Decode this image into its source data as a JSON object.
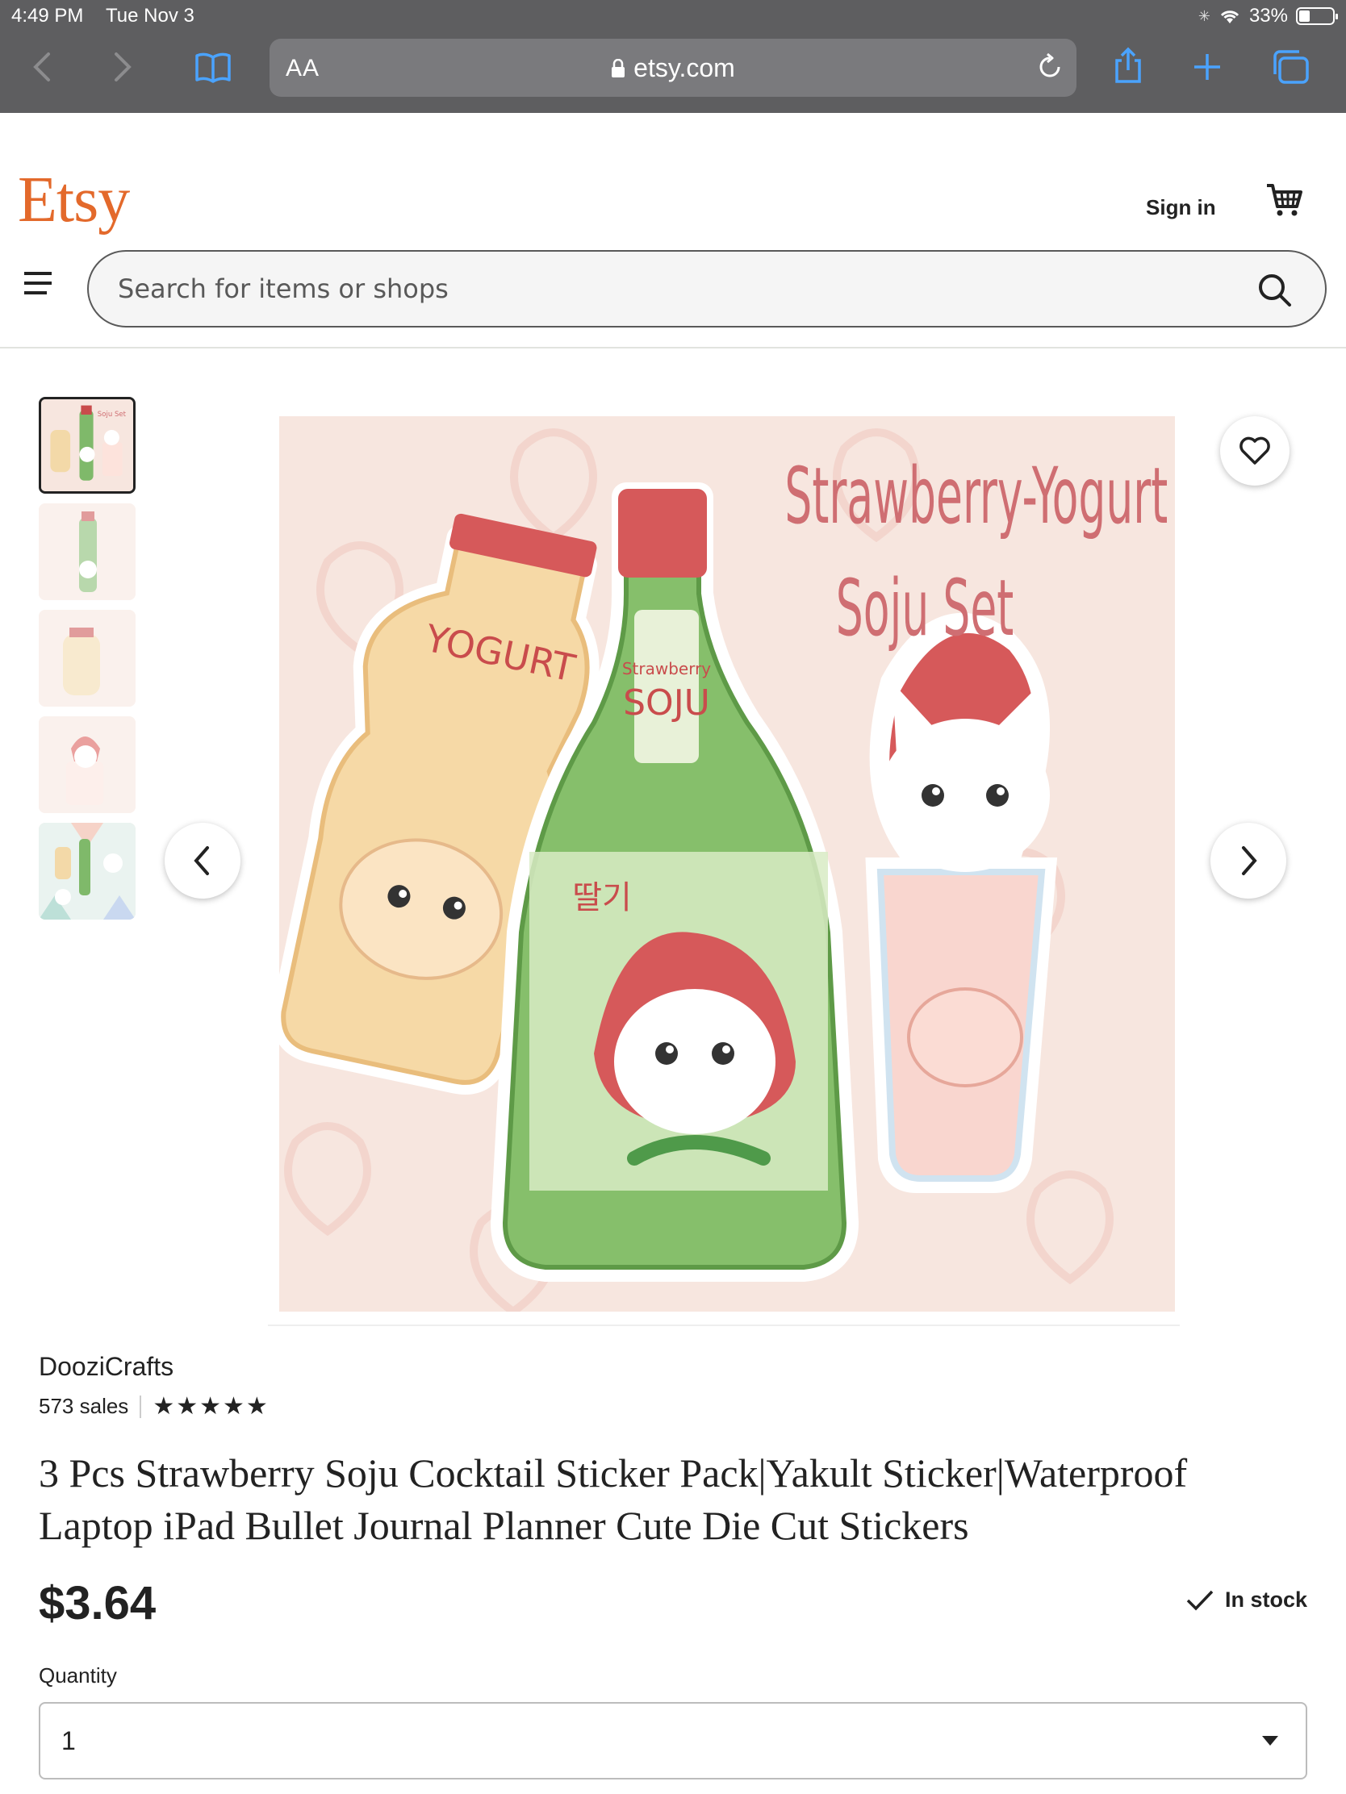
{
  "status_bar": {
    "time": "4:49 PM",
    "date": "Tue Nov 3",
    "battery": "33%",
    "battery_level": 0.33
  },
  "browser": {
    "url_text_size_label": "AA",
    "url": "etsy.com",
    "icons": [
      "back-icon",
      "forward-icon",
      "bookmarks-icon",
      "lock-icon",
      "reload-icon",
      "share-icon",
      "new-tab-icon",
      "tabs-icon"
    ]
  },
  "header": {
    "logo": "Etsy",
    "sign_in": "Sign in",
    "search_placeholder": "Search for items or shops",
    "brand_color": "#e3692b"
  },
  "gallery": {
    "thumbnail_count": 5,
    "active_index": 0,
    "image_lettering": [
      "Strawberry-Yogurt",
      "Soju Set"
    ]
  },
  "listing": {
    "shop_name": "DooziCrafts",
    "sales": "573 sales",
    "rating_stars": 5,
    "stars_text": "★★★★★",
    "title": "3 Pcs Strawberry Soju Cocktail Sticker Pack|Yakult Sticker|Waterproof Laptop iPad Bullet Journal Planner Cute Die Cut Stickers",
    "price": "$3.64",
    "stock_status": "In stock",
    "quantity_label": "Quantity",
    "quantity_value": "1"
  }
}
